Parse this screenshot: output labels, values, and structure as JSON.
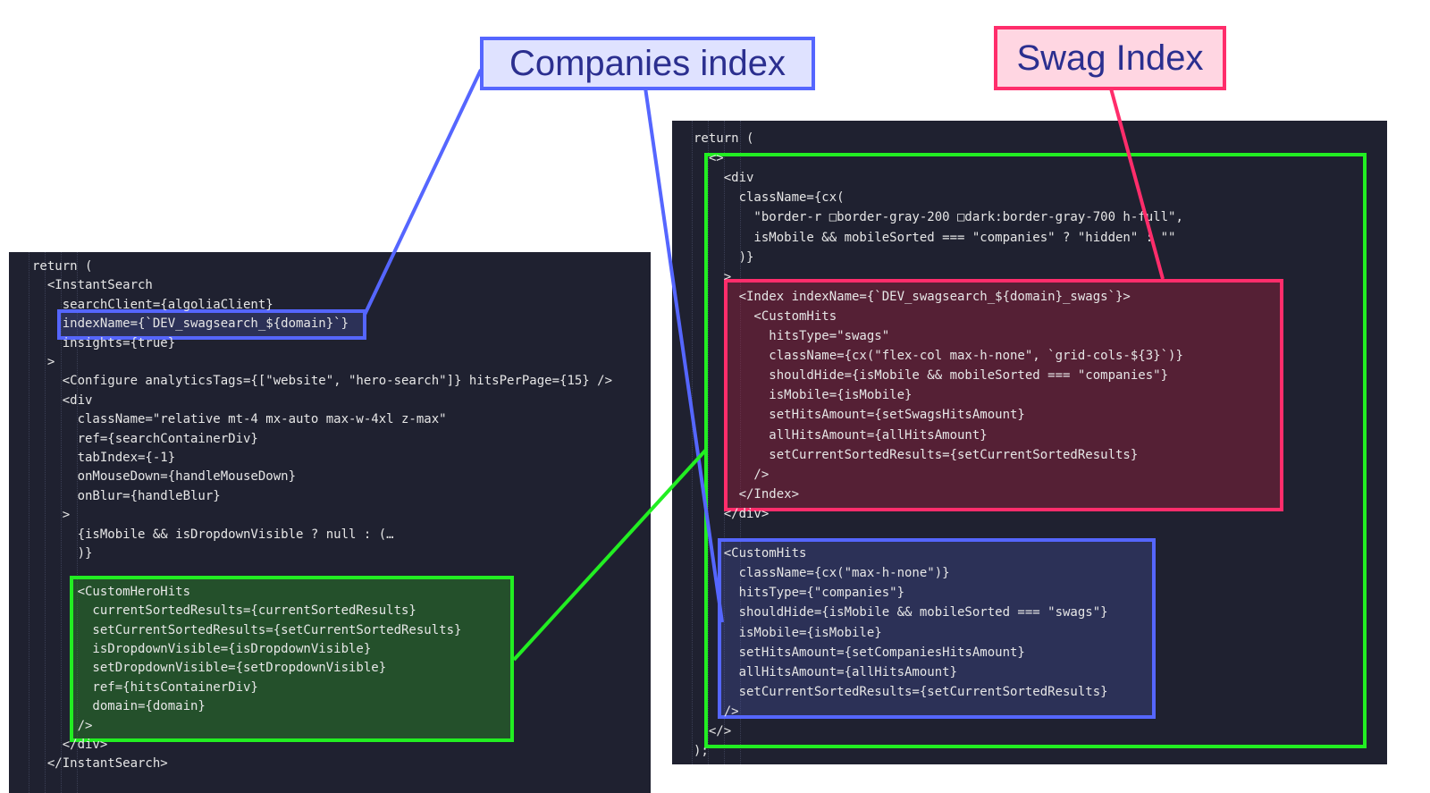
{
  "labels": {
    "companies": "Companies index",
    "swag": "Swag Index"
  },
  "colors": {
    "companies_accent": "#5566ff",
    "swag_accent": "#ff2d6b",
    "hits_accent": "#22ee22",
    "editor_bg": "#1f2130"
  },
  "left_code": [
    "return (",
    "  <InstantSearch",
    "    searchClient={algoliaClient}",
    "    indexName={`DEV_swagsearch_${domain}`}",
    "    insights={true}",
    "  >",
    "    <Configure analyticsTags={[\"website\", \"hero-search\"]} hitsPerPage={15} />",
    "    <div",
    "      className=\"relative mt-4 mx-auto max-w-4xl z-max\"",
    "      ref={searchContainerDiv}",
    "      tabIndex={-1}",
    "      onMouseDown={handleMouseDown}",
    "      onBlur={handleBlur}",
    "    >",
    "      {isMobile && isDropdownVisible ? null : (…",
    "      )}",
    "",
    "      <CustomHeroHits",
    "        currentSortedResults={currentSortedResults}",
    "        setCurrentSortedResults={setCurrentSortedResults}",
    "        isDropdownVisible={isDropdownVisible}",
    "        setDropdownVisible={setDropdownVisible}",
    "        ref={hitsContainerDiv}",
    "        domain={domain}",
    "      />",
    "    </div>",
    "  </InstantSearch>"
  ],
  "right_code": [
    "return (",
    "  <>",
    "    <div",
    "      className={cx(",
    "        \"border-r □border-gray-200 □dark:border-gray-700 h-full\",",
    "        isMobile && mobileSorted === \"companies\" ? \"hidden\" : \"\"",
    "      )}",
    "    >",
    "      <Index indexName={`DEV_swagsearch_${domain}_swags`}>",
    "        <CustomHits",
    "          hitsType=\"swags\"",
    "          className={cx(\"flex-col max-h-none\", `grid-cols-${3}`)}",
    "          shouldHide={isMobile && mobileSorted === \"companies\"}",
    "          isMobile={isMobile}",
    "          setHitsAmount={setSwagsHitsAmount}",
    "          allHitsAmount={allHitsAmount}",
    "          setCurrentSortedResults={setCurrentSortedResults}",
    "        />",
    "      </Index>",
    "    </div>",
    "",
    "    <CustomHits",
    "      className={cx(\"max-h-none\")}",
    "      hitsType={\"companies\"}",
    "      shouldHide={isMobile && mobileSorted === \"swags\"}",
    "      isMobile={isMobile}",
    "      setHitsAmount={setCompaniesHitsAmount}",
    "      allHitsAmount={allHitsAmount}",
    "      setCurrentSortedResults={setCurrentSortedResults}",
    "    />",
    "  </>",
    ");"
  ]
}
